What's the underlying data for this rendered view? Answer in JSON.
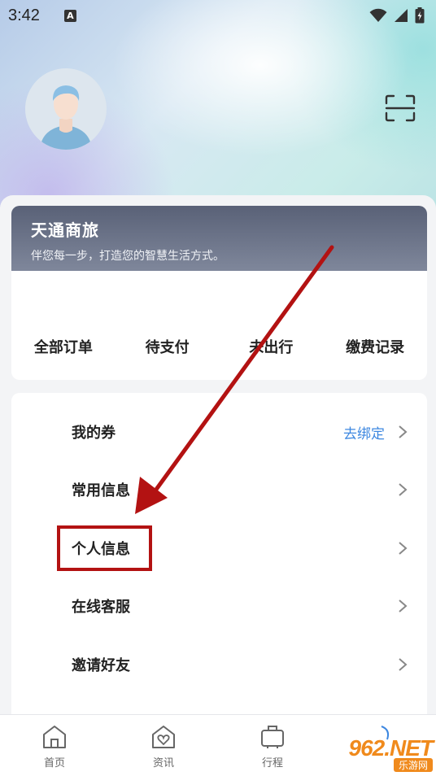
{
  "status_bar": {
    "time": "3:42",
    "notification_icon_letter": "A",
    "icons": [
      "wifi-icon",
      "signal-icon",
      "battery-charging-icon"
    ]
  },
  "header": {
    "avatar_icon": "user-avatar",
    "scan_icon": "scan-icon"
  },
  "brand_card": {
    "title": "天通商旅",
    "subtitle": "伴您每一步，打造您的智慧生活方式。",
    "order_tabs": [
      {
        "label": "全部订单"
      },
      {
        "label": "待支付"
      },
      {
        "label": "未出行"
      },
      {
        "label": "缴费记录"
      }
    ]
  },
  "menu": {
    "items": [
      {
        "label": "我的券",
        "action": "去绑定"
      },
      {
        "label": "常用信息"
      },
      {
        "label": "个人信息"
      },
      {
        "label": "在线客服"
      },
      {
        "label": "邀请好友"
      }
    ]
  },
  "annotation": {
    "color": "#b31212",
    "highlighted_item": "个人信息"
  },
  "tabbar": {
    "tabs": [
      {
        "label": "首页",
        "icon": "home-icon"
      },
      {
        "label": "资讯",
        "icon": "news-heart-icon"
      },
      {
        "label": "行程",
        "icon": "luggage-icon"
      }
    ]
  },
  "watermark": {
    "main": "962.NET",
    "sub": "乐游网"
  },
  "colors": {
    "accent_link": "#3d87e0",
    "banner": "#6b7388",
    "watermark": "#f08a1c"
  }
}
